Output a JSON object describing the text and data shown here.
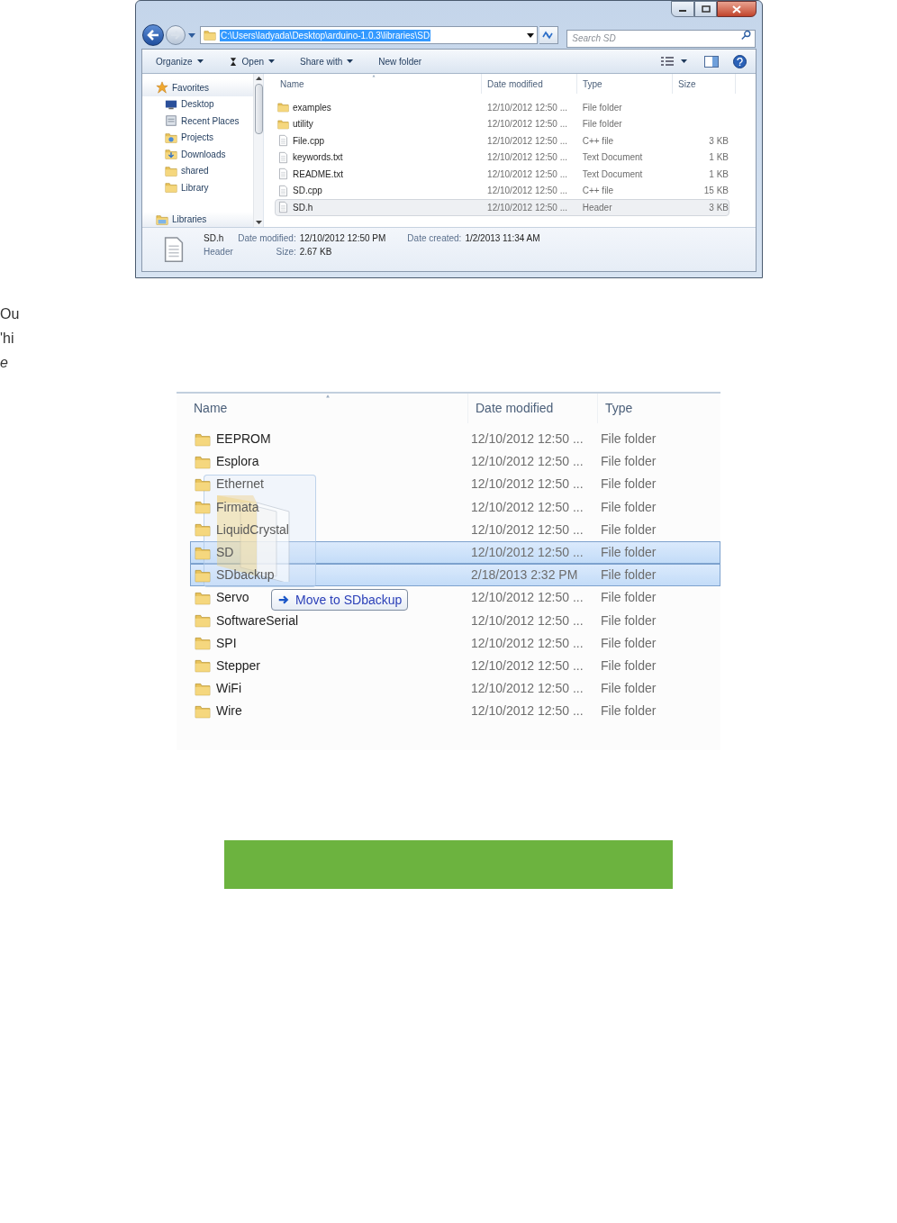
{
  "explorer_window": {
    "address": "C:\\Users\\ladyada\\Desktop\\arduino-1.0.3\\libraries\\SD",
    "search": {
      "placeholder": "Search SD"
    },
    "toolbar": [
      {
        "label": "Organize",
        "dropdown": true,
        "icon": false
      },
      {
        "label": "Open",
        "dropdown": true,
        "icon": true
      },
      {
        "label": "Share with",
        "dropdown": true,
        "icon": false
      },
      {
        "label": "New folder",
        "dropdown": false,
        "icon": false
      }
    ],
    "sidebar": {
      "items": [
        {
          "label": "Favorites",
          "kind": "star",
          "group": true
        },
        {
          "label": "Desktop",
          "kind": "desktop",
          "group": false
        },
        {
          "label": "Recent Places",
          "kind": "recent",
          "group": false
        },
        {
          "label": "Projects",
          "kind": "projects",
          "group": false
        },
        {
          "label": "Downloads",
          "kind": "downloads",
          "group": false
        },
        {
          "label": "shared",
          "kind": "folder",
          "group": false
        },
        {
          "label": "Library",
          "kind": "folder",
          "group": false
        },
        {
          "label": "Libraries",
          "kind": "libraries",
          "group": true
        }
      ]
    },
    "columns": [
      "Name",
      "Date modified",
      "Type",
      "Size"
    ],
    "rows": [
      {
        "kind": "folder",
        "name": "examples",
        "date": "12/10/2012 12:50 ...",
        "type": "File folder",
        "selected": false
      },
      {
        "kind": "folder",
        "name": "utility",
        "date": "12/10/2012 12:50 ...",
        "type": "File folder",
        "selected": false
      },
      {
        "kind": "file",
        "name": "File.cpp",
        "date": "12/10/2012 12:50 ...",
        "type": "C++ file",
        "size": "3 KB",
        "selected": false
      },
      {
        "kind": "file",
        "name": "keywords.txt",
        "date": "12/10/2012 12:50 ...",
        "type": "Text Document",
        "size": "1 KB",
        "selected": false
      },
      {
        "kind": "file",
        "name": "README.txt",
        "date": "12/10/2012 12:50 ...",
        "type": "Text Document",
        "size": "1 KB",
        "selected": false
      },
      {
        "kind": "file",
        "name": "SD.cpp",
        "date": "12/10/2012 12:50 ...",
        "type": "C++ file",
        "size": "15 KB",
        "selected": false
      },
      {
        "kind": "file",
        "name": "SD.h",
        "date": "12/10/2012 12:50 ...",
        "type": "Header",
        "size": "3 KB",
        "selected": true
      }
    ],
    "details": {
      "name": "SD.h",
      "type": "Header",
      "date_modified": {
        "label": "Date modified:",
        "value": "12/10/2012 12:50 PM"
      },
      "size": {
        "label": "Size:",
        "value": "2.67 KB"
      },
      "date_created": {
        "label": "Date created:",
        "value": "1/2/2013 11:34 AM"
      }
    }
  },
  "text_lines": [
    {
      "text": "Ou",
      "italic": false
    },
    {
      "text": "'hi",
      "italic": false
    },
    {
      "text": "e",
      "italic": true
    }
  ],
  "folder_listing": {
    "columns": [
      "Name",
      "Date modified",
      "Type"
    ],
    "rows": [
      {
        "name": "EEPROM",
        "date": "12/10/2012 12:50 ...",
        "type": "File folder",
        "selected": false,
        "dragged": false
      },
      {
        "name": "Esplora",
        "date": "12/10/2012 12:50 ...",
        "type": "File folder",
        "selected": false,
        "dragged": false
      },
      {
        "name": "Ethernet",
        "date": "12/10/2012 12:50 ...",
        "type": "File folder",
        "selected": false,
        "dragged": true
      },
      {
        "name": "Firmata",
        "date": "12/10/2012 12:50 ...",
        "type": "File folder",
        "selected": false,
        "dragged": true
      },
      {
        "name": "LiquidCrystal",
        "date": "12/10/2012 12:50 ...",
        "type": "File folder",
        "selected": false,
        "dragged": true
      },
      {
        "name": "SD",
        "date": "12/10/2012 12:50 ...",
        "type": "File folder",
        "selected": true,
        "dragged": true
      },
      {
        "name": "SDbackup",
        "date": "2/18/2013 2:32 PM",
        "type": "File folder",
        "selected": true,
        "dragged": true
      },
      {
        "name": "Servo",
        "date": "12/10/2012 12:50 ...",
        "type": "File folder",
        "selected": false,
        "dragged": false
      },
      {
        "name": "SoftwareSerial",
        "date": "12/10/2012 12:50 ...",
        "type": "File folder",
        "selected": false,
        "dragged": false
      },
      {
        "name": "SPI",
        "date": "12/10/2012 12:50 ...",
        "type": "File folder",
        "selected": false,
        "dragged": false
      },
      {
        "name": "Stepper",
        "date": "12/10/2012 12:50 ...",
        "type": "File folder",
        "selected": false,
        "dragged": false
      },
      {
        "name": "WiFi",
        "date": "12/10/2012 12:50 ...",
        "type": "File folder",
        "selected": false,
        "dragged": false
      },
      {
        "name": "Wire",
        "date": "12/10/2012 12:50 ...",
        "type": "File folder",
        "selected": false,
        "dragged": false
      }
    ],
    "drag_tooltip": "Move to SDbackup"
  }
}
